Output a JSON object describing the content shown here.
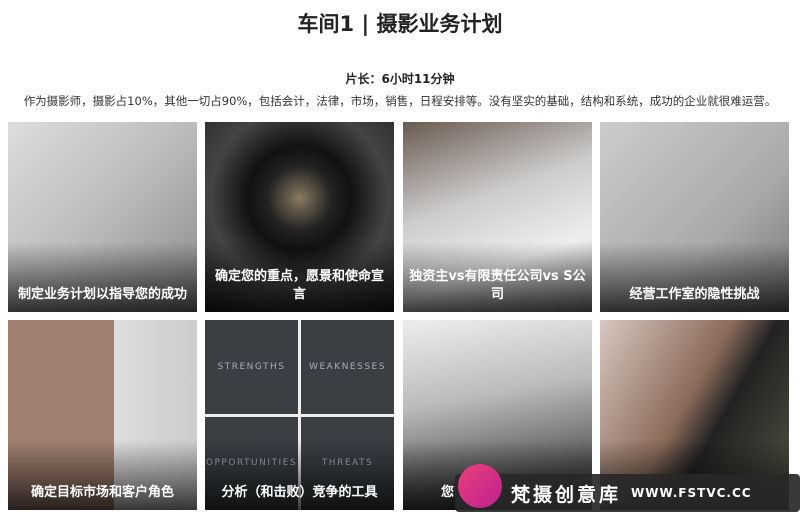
{
  "title": "车间1 | 摄影业务计划",
  "duration": "片长：6小时11分钟",
  "description": "作为摄影师，摄影占10%，其他一切占90%，包括会计，法律，市场，销售，日程安排等。没有坚实的基础，结构和系统，成功的企业就很难运营。",
  "lessons": [
    {
      "label": "制定业务计划以指导您的成功"
    },
    {
      "label": "确定您的重点，愿景和使命宣言"
    },
    {
      "label": "独资主vs有限责任公司vs S公司"
    },
    {
      "label": "经营工作室的隐性挑战"
    },
    {
      "label": "确定目标市场和客户角色"
    },
    {
      "label": "分析（和击败）竞争的工具"
    },
    {
      "label": "您"
    },
    {
      "label": ""
    }
  ],
  "swot": [
    "STRENGTHS",
    "WEAKNESSES",
    "OPPORTUNITIES",
    "THREATS"
  ],
  "watermark": {
    "logo": "FS",
    "name": "梵摄创意库",
    "url": "WWW.FSTVC.CC"
  }
}
